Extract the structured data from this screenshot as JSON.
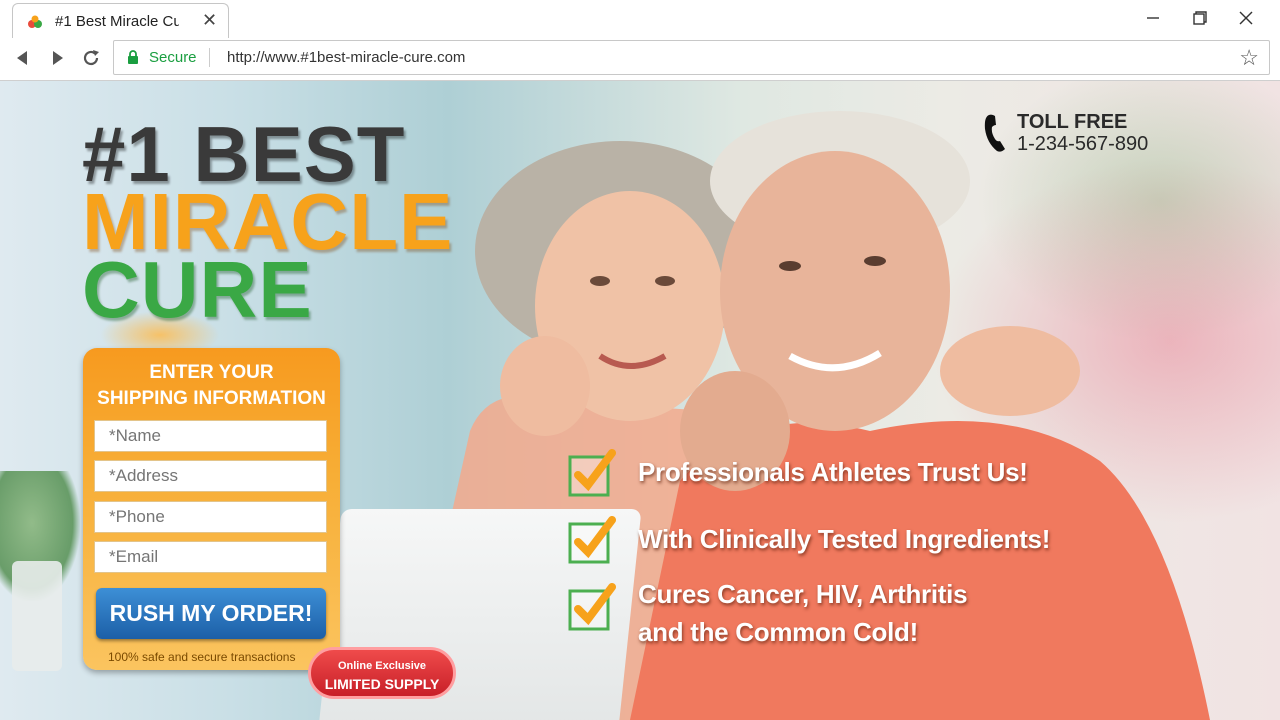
{
  "browser": {
    "tab_title": "#1 Best Miracle Cur",
    "secure_label": "Secure",
    "url": "http://www.#1best-miracle-cure.com"
  },
  "logo": {
    "line1": "#1 BEST",
    "line2": "MIRACLE",
    "line3": "CURE"
  },
  "contact": {
    "toll_free_label": "TOLL FREE",
    "phone": "1-234-567-890"
  },
  "form": {
    "heading_line1": "ENTER YOUR",
    "heading_line2": "SHIPPING INFORMATION",
    "fields": {
      "name_placeholder": "*Name",
      "address_placeholder": "*Address",
      "phone_placeholder": "*Phone",
      "email_placeholder": "*Email"
    },
    "submit_label": "RUSH MY ORDER!",
    "safe_note": "100% safe and secure transactions"
  },
  "badge": {
    "line1": "Online Exclusive",
    "line2": "LIMITED SUPPLY"
  },
  "claims": {
    "item1": "Professionals Athletes Trust Us!",
    "item2": "With Clinically Tested Ingredients!",
    "item3_line1": "Cures Cancer, HIV, Arthritis",
    "item3_line2": "and the Common Cold!"
  },
  "colors": {
    "logo_dark": "#3a3a3a",
    "logo_orange": "#f7a21b",
    "logo_green": "#3aa845",
    "form_orange": "#f79a1f",
    "button_blue": "#1c5fa7",
    "badge_red": "#c81f28",
    "secure_green": "#1a9e40"
  }
}
